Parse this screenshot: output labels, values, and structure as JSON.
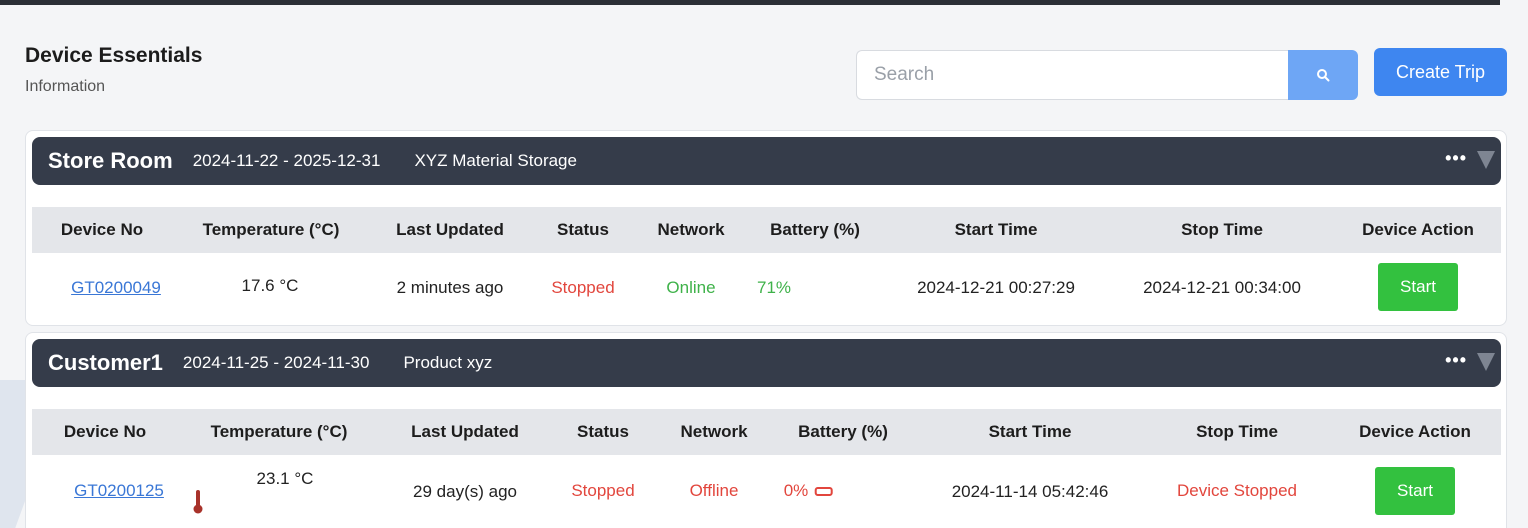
{
  "header": {
    "title": "Device Essentials",
    "subtitle": "Information"
  },
  "search": {
    "placeholder": "Search",
    "icon": "search-icon"
  },
  "actions": {
    "create_trip": "Create Trip"
  },
  "colors": {
    "header_bg": "#353c4a",
    "primary": "#3e86f0",
    "success": "#33c13f",
    "danger": "#e2463d",
    "ok": "#3fb24a"
  },
  "columns": [
    "Device No",
    "Temperature (°C)",
    "Last Updated",
    "Status",
    "Network",
    "Battery (%)",
    "Start Time",
    "Stop Time",
    "Device Action"
  ],
  "trips": [
    {
      "name": "Store Room",
      "dates": "2024-11-22 - 2025-12-31",
      "description": "XYZ Material Storage",
      "row": {
        "device_no": "GT0200049",
        "temperature": "17.6 °C",
        "last_updated": "2 minutes ago",
        "status": "Stopped",
        "network": "Online",
        "battery": "71%",
        "start_time": "2024-12-21 00:27:29",
        "stop_time": "2024-12-21 00:34:00",
        "action": "Start"
      }
    },
    {
      "name": "Customer1",
      "dates": "2024-11-25 - 2024-11-30",
      "description": "Product xyz",
      "row": {
        "device_no": "GT0200125",
        "temperature": "23.1 °C",
        "last_updated": "29 day(s) ago",
        "status": "Stopped",
        "network": "Offline",
        "battery": "0%",
        "start_time": "2024-11-14 05:42:46",
        "stop_time": "Device Stopped",
        "action": "Start"
      }
    }
  ]
}
